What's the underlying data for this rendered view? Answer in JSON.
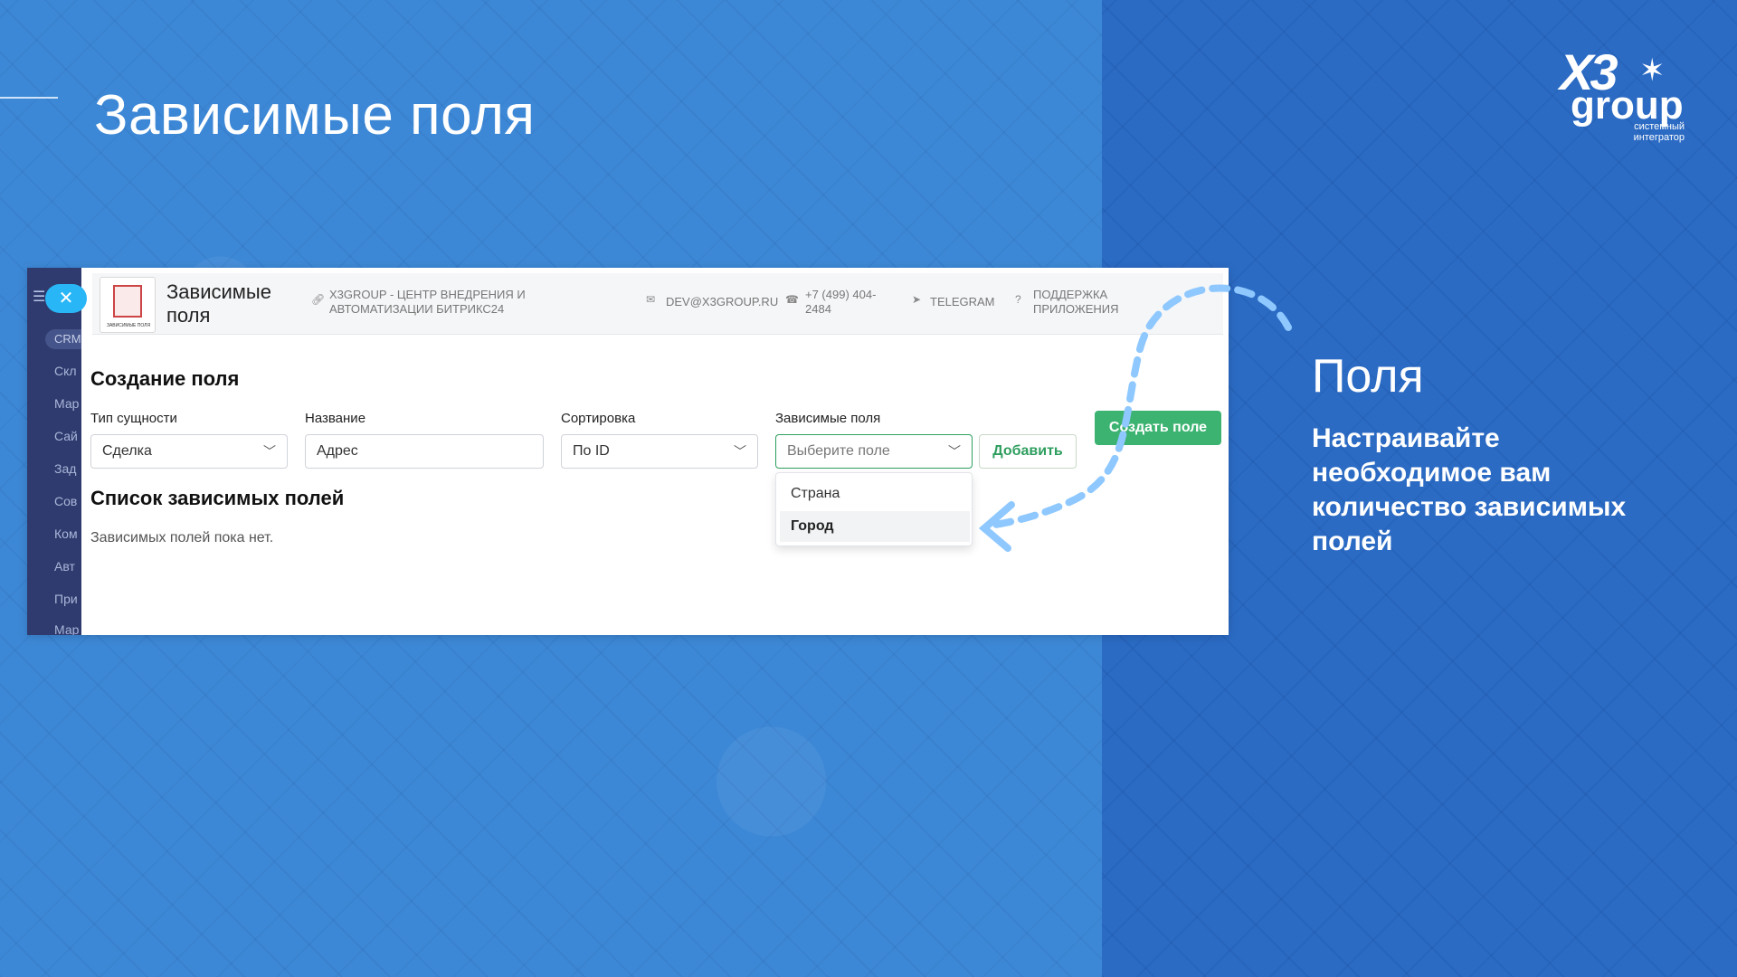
{
  "slide": {
    "title": "Зависимые поля",
    "side_heading": "Поля",
    "side_text": "Настраивайте необходимое вам количество зависимых полей"
  },
  "logo": {
    "main": "X3",
    "word": "group",
    "sub": "системный интегратор"
  },
  "colors": {
    "bg_left": "#3d88d6",
    "bg_right": "#2b6bc4",
    "accent_green": "#3cb371",
    "arrow": "#8ec8ff"
  },
  "sidebar": {
    "pill": "CRM",
    "items": [
      "Скл",
      "Мар",
      "Сай",
      "Зад",
      "Сов",
      "Ком",
      "Авт",
      "При",
      "Мар"
    ]
  },
  "header": {
    "app_name": "Зависимые поля",
    "logo_caption": "ЗАВИСИМЫЕ ПОЛЯ",
    "company_link": "X3GROUP - ЦЕНТР ВНЕДРЕНИЯ И АВТОМАТИЗАЦИИ БИТРИКС24",
    "email": "DEV@X3GROUP.RU",
    "phone": "+7 (499) 404-2484",
    "telegram": "TELEGRAM",
    "support": "ПОДДЕРЖКА ПРИЛОЖЕНИЯ"
  },
  "form": {
    "section_title": "Создание поля",
    "entity_label": "Тип сущности",
    "entity_value": "Сделка",
    "name_label": "Название",
    "name_value": "Адрес",
    "sort_label": "Сортировка",
    "sort_value": "По ID",
    "dependent_label": "Зависимые поля",
    "dependent_placeholder": "Выберите поле",
    "add_button": "Добавить",
    "create_button": "Создать поле",
    "dropdown_options": [
      "Страна",
      "Город"
    ]
  },
  "list": {
    "section_title": "Список зависимых полей",
    "empty_text": "Зависимых полей пока нет."
  }
}
